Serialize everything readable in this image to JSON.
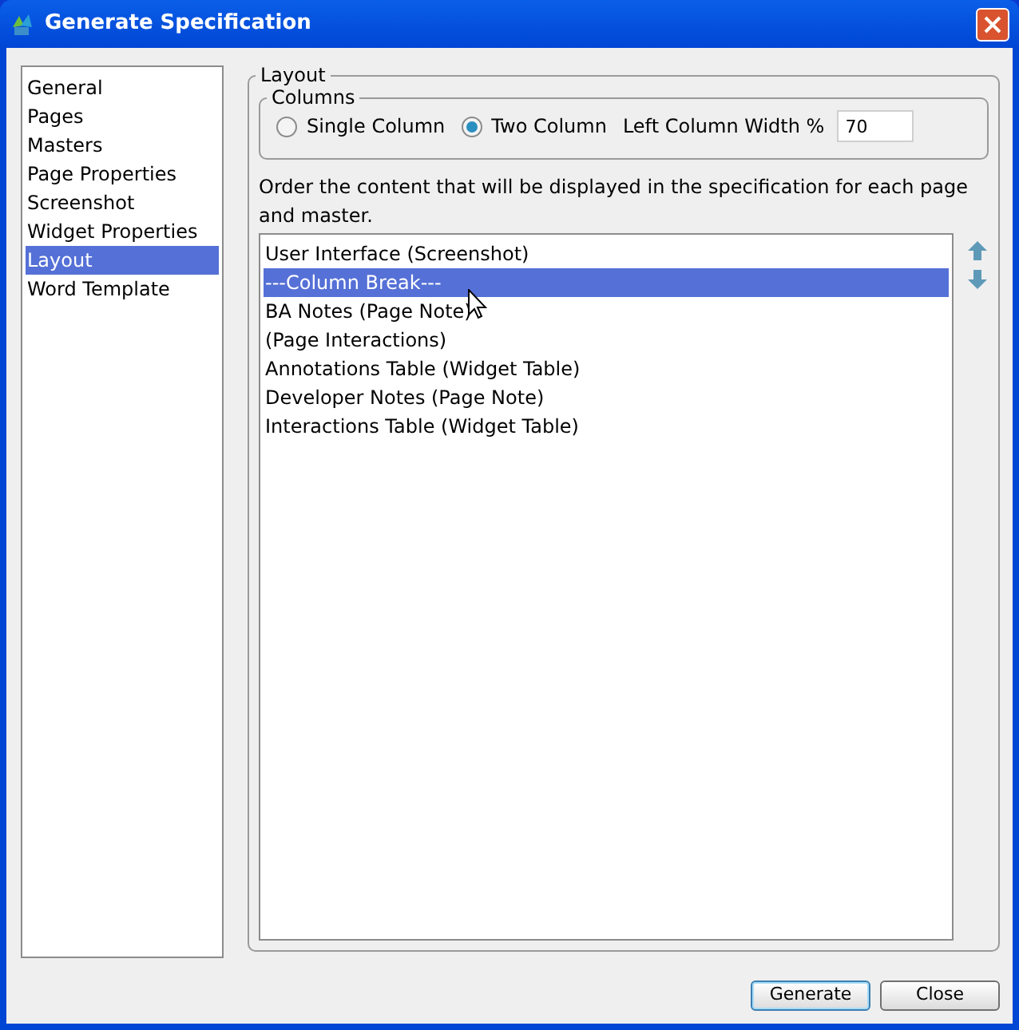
{
  "window": {
    "title": "Generate Specification"
  },
  "sidebar": {
    "items": [
      {
        "label": "General",
        "selected": false
      },
      {
        "label": "Pages",
        "selected": false
      },
      {
        "label": "Masters",
        "selected": false
      },
      {
        "label": "Page Properties",
        "selected": false
      },
      {
        "label": "Screenshot",
        "selected": false
      },
      {
        "label": "Widget Properties",
        "selected": false
      },
      {
        "label": "Layout",
        "selected": true
      },
      {
        "label": "Word Template",
        "selected": false
      }
    ]
  },
  "layout": {
    "title": "Layout",
    "columns": {
      "title": "Columns",
      "options": [
        {
          "label": "Single Column",
          "selected": false
        },
        {
          "label": "Two Column",
          "selected": true
        }
      ],
      "width_label": "Left Column Width %",
      "width_value": "70"
    },
    "description": "Order the content that will be displayed in the specification for each page and master.",
    "items": [
      {
        "label": "User Interface (Screenshot)",
        "selected": false
      },
      {
        "label": "---Column Break---",
        "selected": true
      },
      {
        "label": "BA Notes (Page Note)",
        "selected": false
      },
      {
        "label": "(Page Interactions)",
        "selected": false
      },
      {
        "label": "Annotations Table (Widget Table)",
        "selected": false
      },
      {
        "label": "Developer Notes (Page Note)",
        "selected": false
      },
      {
        "label": "Interactions Table (Widget Table)",
        "selected": false
      }
    ]
  },
  "buttons": [
    {
      "label": "Generate",
      "default": true
    },
    {
      "label": "Close",
      "default": false
    }
  ]
}
